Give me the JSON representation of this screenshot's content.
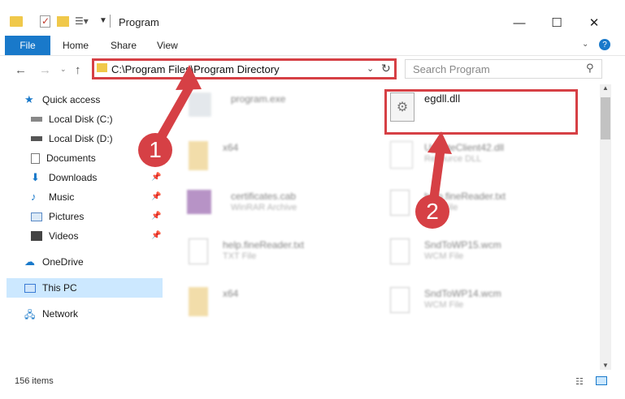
{
  "window": {
    "title": "Program"
  },
  "ribbon": {
    "file": "File",
    "home": "Home",
    "share": "Share",
    "view": "View"
  },
  "address": {
    "path": "C:\\Program Files\\Program Directory"
  },
  "search": {
    "placeholder": "Search Program"
  },
  "sidebar": {
    "quick_access": "Quick access",
    "local_c": "Local Disk (C:)",
    "local_d": "Local Disk (D:)",
    "documents": "Documents",
    "downloads": "Downloads",
    "music": "Music",
    "pictures": "Pictures",
    "videos": "Videos",
    "onedrive": "OneDrive",
    "thispc": "This PC",
    "network": "Network"
  },
  "files": {
    "f1": {
      "name": "program.exe"
    },
    "f2": {
      "name": "x64"
    },
    "f3": {
      "name": "certificates.cab",
      "type": "WinRAR Archive"
    },
    "f4": {
      "name": "help.fineReader.txt",
      "type": "TXT File"
    },
    "f5": {
      "name": "x64"
    },
    "g1": {
      "name": "egdll.dll"
    },
    "g2": {
      "name": "UpdateClient42.dll",
      "type": "Resource DLL"
    },
    "g3": {
      "name": "help.fineReader.txt",
      "type": "TXT File"
    },
    "g4": {
      "name": "SndToWP15.wcm",
      "type": "WCM File"
    },
    "g5": {
      "name": "SndToWP14.wcm",
      "type": "WCM File"
    }
  },
  "status": {
    "items": "156 items"
  },
  "annotations": {
    "step1": "1",
    "step2": "2",
    "color": "#d64045"
  }
}
